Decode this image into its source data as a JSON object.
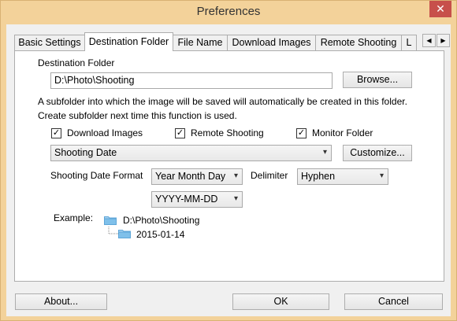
{
  "window": {
    "title": "Preferences",
    "close_glyph": "✕"
  },
  "tabs": [
    {
      "label": "Basic Settings",
      "active": false
    },
    {
      "label": "Destination Folder",
      "active": true
    },
    {
      "label": "File Name",
      "active": false
    },
    {
      "label": "Download Images",
      "active": false
    },
    {
      "label": "Remote Shooting",
      "active": false
    },
    {
      "label": "L",
      "active": false
    }
  ],
  "tab_scroll": {
    "left_icon": "◀",
    "right_icon": "▶"
  },
  "destination": {
    "heading": "Destination Folder",
    "path_value": "D:\\Photo\\Shooting",
    "browse_label": "Browse...",
    "info_line1": "A subfolder into which the image will be saved will automatically be created in this folder.",
    "info_line2": "Create subfolder next time this function is used.",
    "checkboxes": [
      {
        "label": "Download Images",
        "checked": true
      },
      {
        "label": "Remote Shooting",
        "checked": true
      },
      {
        "label": "Monitor Folder",
        "checked": true
      }
    ],
    "check_glyph": "✓",
    "subfolder_select": "Shooting Date",
    "customize_label": "Customize...",
    "date_format_label": "Shooting Date Format",
    "date_format_value": "Year Month Day",
    "delimiter_label": "Delimiter",
    "delimiter_value": "Hyphen",
    "date_pattern_value": "YYYY-MM-DD",
    "example_label": "Example:",
    "example_root": "D:\\Photo\\Shooting",
    "example_sub": "2015-01-14",
    "chevron_glyph": "▾"
  },
  "footer": {
    "about_label": "About...",
    "ok_label": "OK",
    "cancel_label": "Cancel"
  },
  "colors": {
    "titlebar": "#f3d29a",
    "close_button": "#c7504b",
    "folder_icon": "#5ea6d8"
  }
}
